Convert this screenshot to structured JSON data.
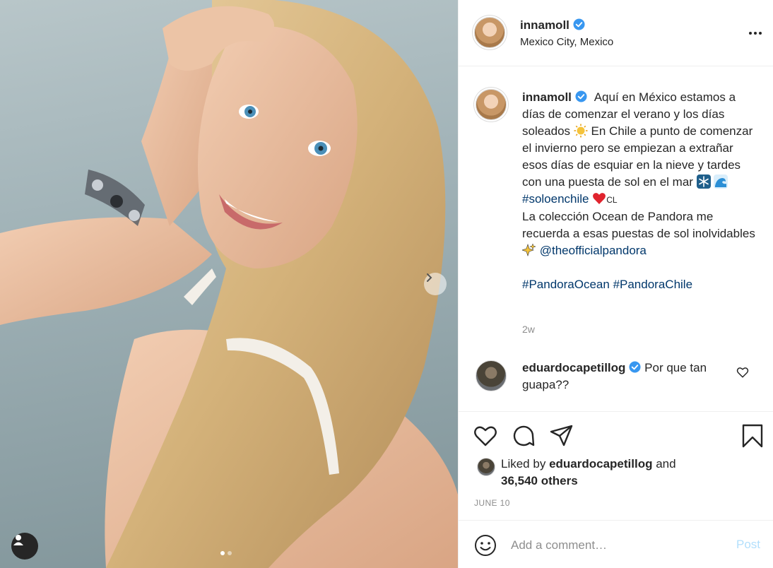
{
  "post": {
    "author": "innamoll",
    "location": "Mexico City, Mexico",
    "caption_lines": [
      "Aquí en México estamos a días de comenzar el verano y los días soleados",
      "En Chile a punto de comenzar el invierno pero se empiezan a extrañar esos días de esquiar en la nieve y tardes con una puesta de sol en el mar",
      "#soloenchile",
      "CL",
      "La colección Ocean de Pandora me recuerda a esas puestas de sol inolvidables",
      "@theofficialpandora",
      "#PandoraOcean",
      "#PandoraChile"
    ],
    "time_ago": "2w",
    "date": "JUNE 10",
    "carousel": {
      "current": 1,
      "total": 2
    }
  },
  "comment": {
    "author": "eduardocapetillog",
    "text": "Por que tan guapa??"
  },
  "likes": {
    "prefix": "Liked by",
    "user": "eduardocapetillog",
    "conjunction": "and",
    "others": "36,540 others"
  },
  "add_comment": {
    "placeholder": "Add a comment…",
    "post_label": "Post"
  },
  "icons": {
    "verified": "verified-badge-icon",
    "more": "more-options-icon",
    "like": "heart-icon",
    "comment": "comment-bubble-icon",
    "share": "paper-plane-icon",
    "save": "bookmark-icon",
    "emoji": "smiley-icon",
    "tag": "user-tag-icon",
    "next": "chevron-right-icon"
  },
  "colors": {
    "link": "#00376b",
    "verified": "#3897f0",
    "muted": "#8e8e8e",
    "post_disabled": "#b2dffc",
    "text": "#262626"
  }
}
